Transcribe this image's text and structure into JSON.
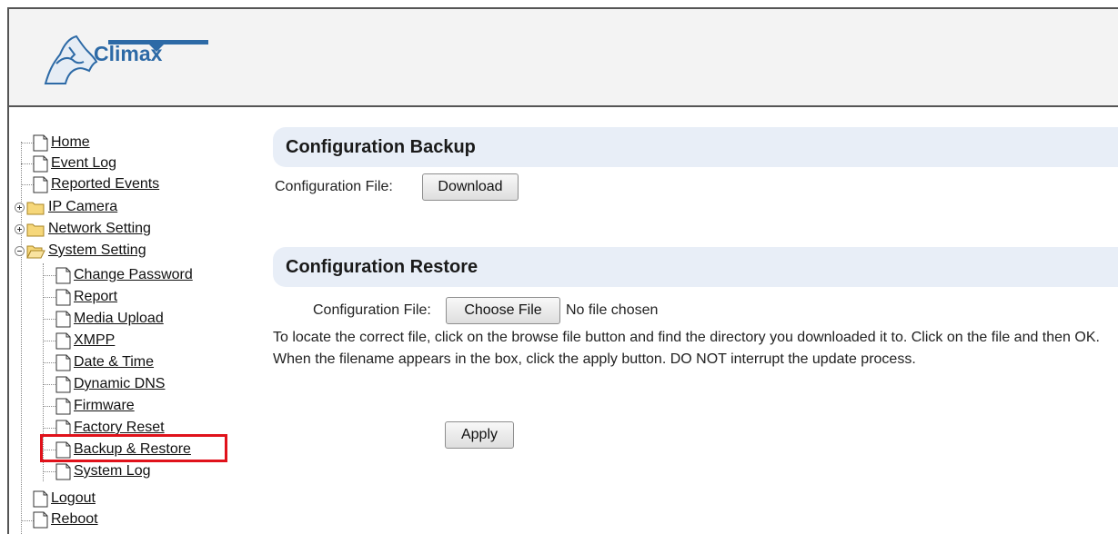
{
  "brand": {
    "name": "Climax"
  },
  "sidebar": {
    "items": [
      {
        "label": "Home"
      },
      {
        "label": "Event Log"
      },
      {
        "label": "Reported Events"
      },
      {
        "label": "IP Camera"
      },
      {
        "label": "Network Setting"
      },
      {
        "label": "System Setting"
      },
      {
        "label": "Logout"
      },
      {
        "label": "Reboot"
      }
    ],
    "system_children": [
      {
        "label": "Change Password"
      },
      {
        "label": "Report"
      },
      {
        "label": "Media Upload"
      },
      {
        "label": "XMPP"
      },
      {
        "label": "Date & Time"
      },
      {
        "label": "Dynamic DNS"
      },
      {
        "label": "Firmware"
      },
      {
        "label": "Factory Reset"
      },
      {
        "label": "Backup & Restore"
      },
      {
        "label": "System Log"
      }
    ],
    "selected": "Backup & Restore"
  },
  "backup": {
    "title": "Configuration Backup",
    "file_label": "Configuration File:",
    "download_label": "Download"
  },
  "restore": {
    "title": "Configuration Restore",
    "file_label": "Configuration File:",
    "choose_label": "Choose File",
    "no_file_text": "No file chosen",
    "instructions": "To locate the correct file, click on the browse file button and find the directory you downloaded it to. Click on the file and then OK. When the filename appears in the box, click the apply button. DO NOT interrupt the update process.",
    "apply_label": "Apply"
  },
  "colors": {
    "section_bar": "#e8eef7",
    "highlight": "#e0121b",
    "brand_blue": "#2d6aa6"
  }
}
